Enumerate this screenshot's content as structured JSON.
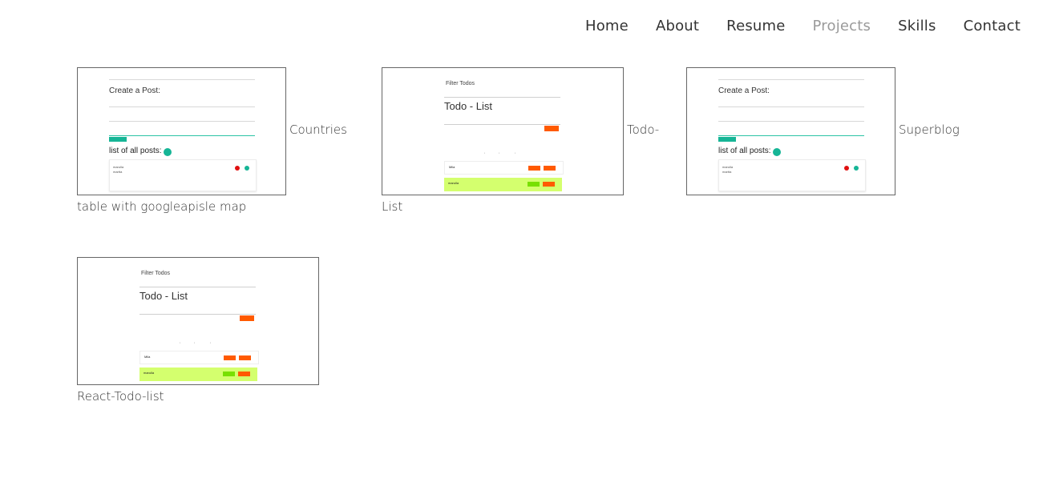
{
  "nav": {
    "items": [
      {
        "label": "Home",
        "active": false
      },
      {
        "label": "About",
        "active": false
      },
      {
        "label": "Resume",
        "active": false
      },
      {
        "label": "Projects",
        "active": true
      },
      {
        "label": "Skills",
        "active": false
      },
      {
        "label": "Contact",
        "active": false
      }
    ],
    "active_color": "#9a9a9a"
  },
  "projects": [
    {
      "caption_side": "Countries",
      "caption_below": "table with googleapisle map",
      "preview": "blog"
    },
    {
      "caption_side": "Todo-",
      "caption_below": "List",
      "preview": "todo"
    },
    {
      "caption_side": "Superblog",
      "caption_below": "",
      "preview": "blog"
    },
    {
      "caption_side": "",
      "caption_below": "React-Todo-list",
      "preview": "todo"
    }
  ],
  "preview_blog": {
    "title": "Create a Post:",
    "list_title": "list of all posts:",
    "post_author": "marulla",
    "post_title": "martta"
  },
  "preview_todo": {
    "filter_label": "Filter Todos",
    "heading": "Todo - List",
    "item_1": "Mila",
    "item_2": "marulla"
  },
  "colors": {
    "accent_teal": "#16b596",
    "todo_orange": "#ff5a00",
    "todo_highlight": "#d4ff6e"
  }
}
